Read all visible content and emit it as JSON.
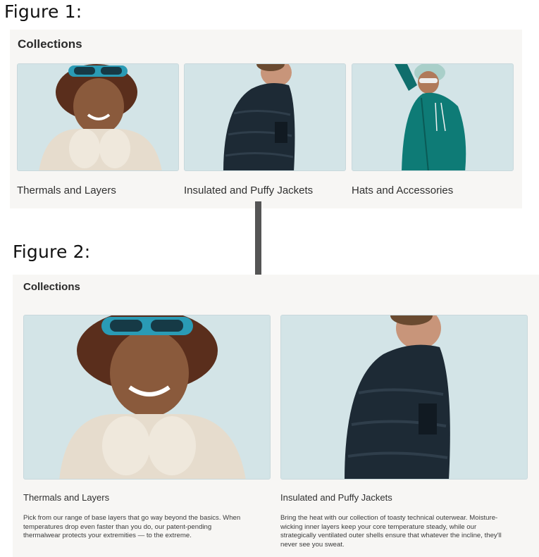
{
  "figure1": {
    "label": "Figure 1:",
    "heading": "Collections",
    "cards": [
      {
        "title": "Thermals and Layers",
        "image": "woman-in-winter-jacket-photo"
      },
      {
        "title": "Insulated and Puffy Jackets",
        "image": "man-in-puffy-jacket-photo"
      },
      {
        "title": "Hats and Accessories",
        "image": "woman-in-teal-raincoat-photo"
      }
    ]
  },
  "figure2": {
    "label": "Figure 2:",
    "heading": "Collections",
    "cards": [
      {
        "title": "Thermals and Layers",
        "image": "woman-in-winter-jacket-photo",
        "desc_lines": [
          "Pick from our range of base layers that go way beyond the basics. When",
          "temperatures drop even faster than you do, our patent-pending",
          "thermalwear protects your extremities — to the extreme."
        ]
      },
      {
        "title": "Insulated and Puffy Jackets",
        "image": "man-in-puffy-jacket-photo",
        "desc_lines": [
          "Bring the heat with our collection of toasty technical outerwear. Moisture-",
          "wicking inner layers keep your core temperature steady, while our",
          "strategically ventilated outer shells ensure that whatever the incline, they'll",
          "never see you sweat."
        ]
      }
    ]
  },
  "colors": {
    "panel_bg": "#f7f6f4",
    "photo_bg": "#cfe2e6",
    "arrow": "#555555"
  }
}
